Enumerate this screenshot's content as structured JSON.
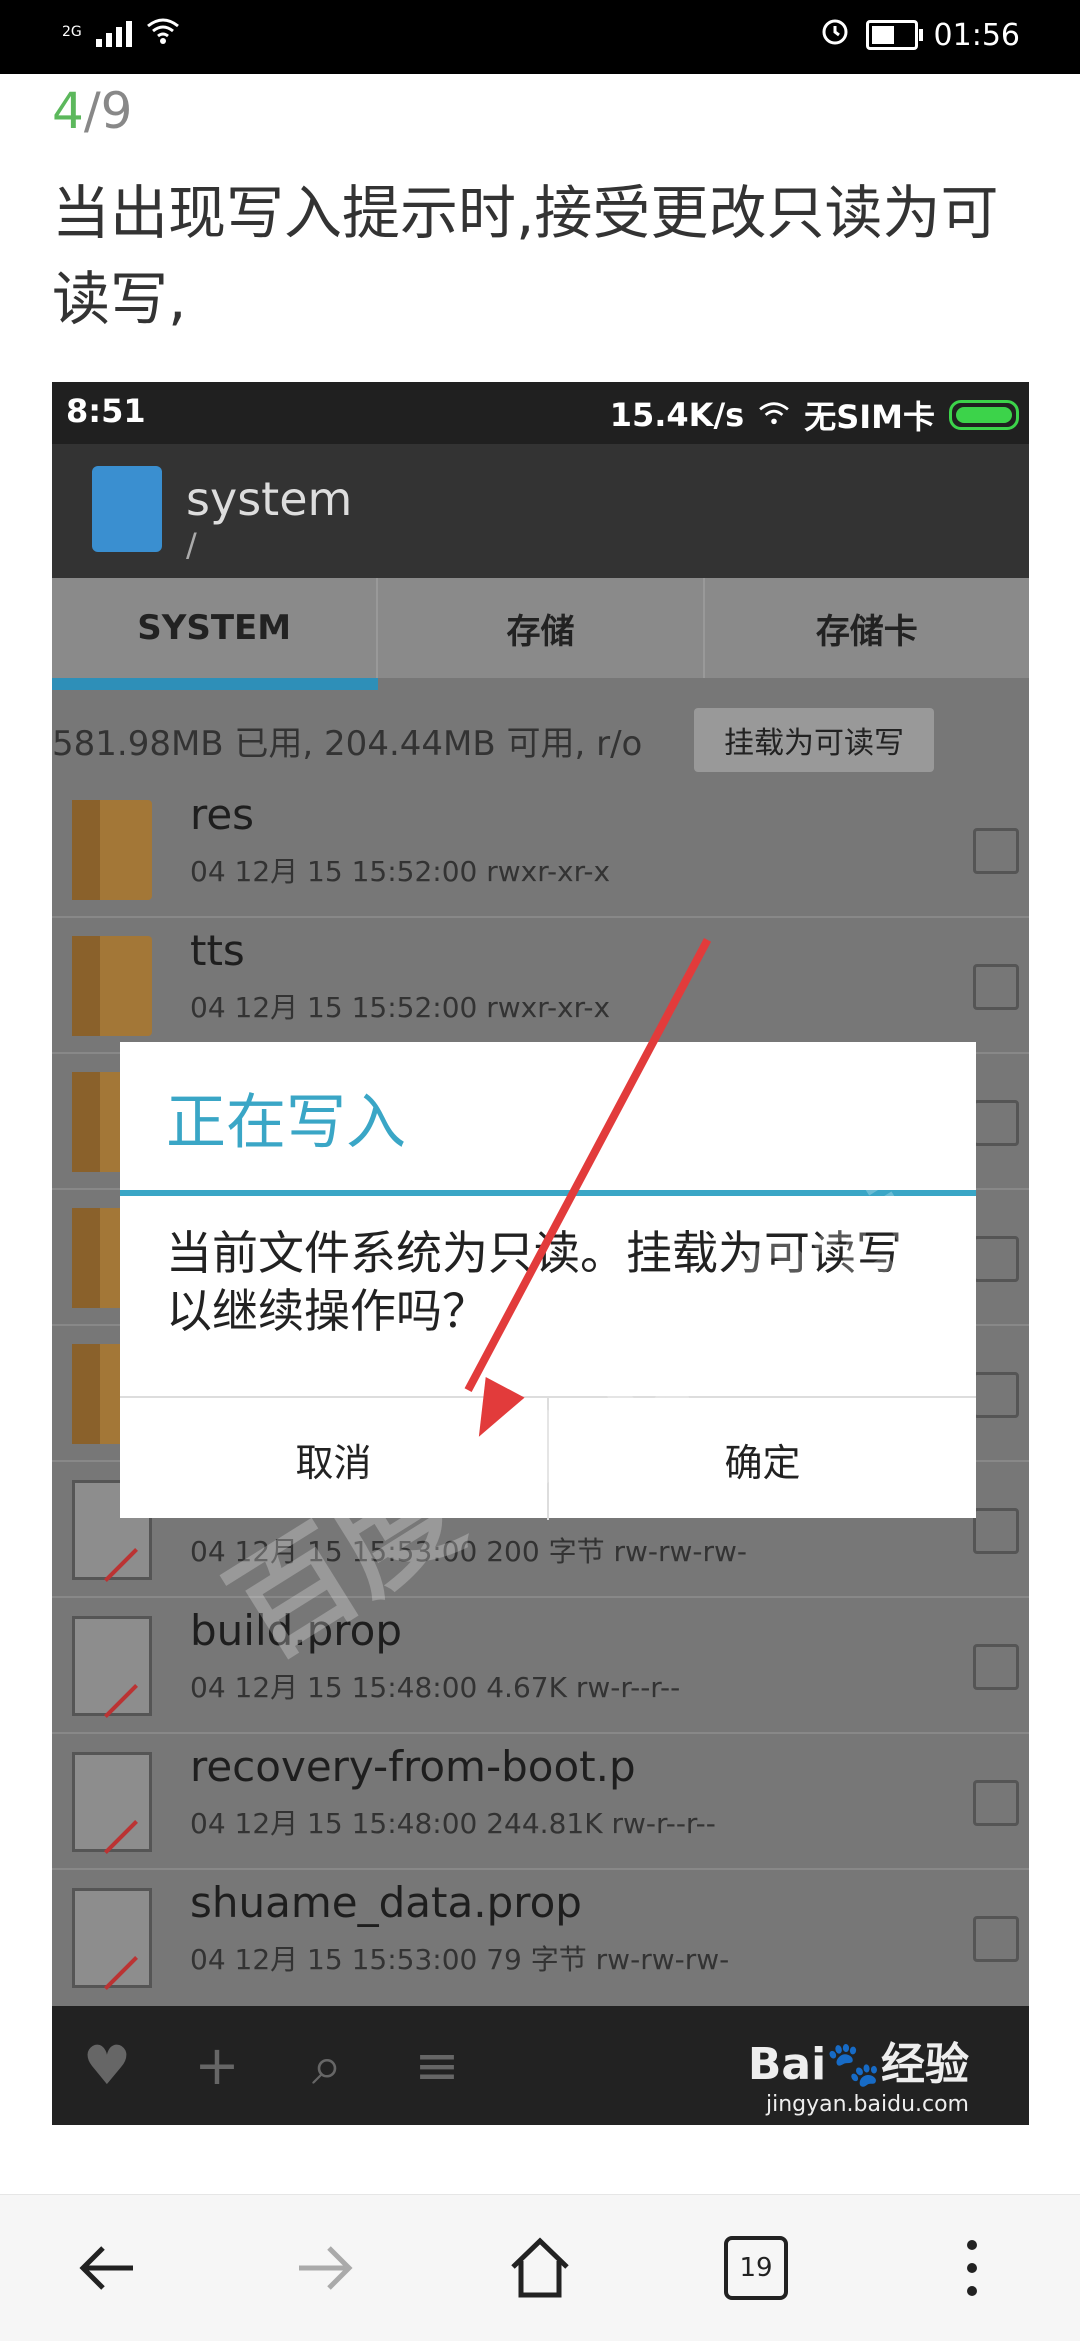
{
  "status_bar": {
    "network": "2G",
    "time": "01:56"
  },
  "article": {
    "step_current": "4",
    "step_total": "/9",
    "instruction": "当出现写入提示时,接受更改只读为可读写,"
  },
  "screenshot": {
    "status": {
      "time": "8:51",
      "speed": "15.4K/s",
      "sim": "无SIM卡"
    },
    "app": {
      "title": "system",
      "path": "/"
    },
    "tabs": [
      "SYSTEM",
      "存储",
      "存储卡"
    ],
    "storage_info": "581.98MB 已用, 204.44MB 可用, r/o",
    "mount_button": "挂载为可读写",
    "files": [
      {
        "name": "res",
        "meta": "04 12月 15 15:52:00   rwxr-xr-x",
        "type": "folder"
      },
      {
        "name": "tts",
        "meta": "04 12月 15 15:52:00   rwxr-xr-x",
        "type": "folder"
      },
      {
        "name": "",
        "meta": "",
        "type": "folder"
      },
      {
        "name": "",
        "meta": "",
        "type": "folder"
      },
      {
        "name": "",
        "meta": "",
        "type": "folder"
      },
      {
        "name": "",
        "meta": "04 12月 15 15:53:00  200 字节  rw-rw-rw-",
        "type": "file"
      },
      {
        "name": "build.prop",
        "meta": "04 12月 15 15:48:00  4.67K  rw-r--r--",
        "type": "file"
      },
      {
        "name": "recovery-from-boot.p",
        "meta": "04 12月 15 15:48:00  244.81K  rw-r--r--",
        "type": "file"
      },
      {
        "name": "shuame_data.prop",
        "meta": "04 12月 15 15:53:00  79 字节  rw-rw-rw-",
        "type": "file"
      }
    ],
    "dialog": {
      "title": "正在写入",
      "message": "当前文件系统为只读。挂载为可读写以继续操作吗？",
      "cancel": "取消",
      "confirm": "确定"
    },
    "watermark": "百度 D gu0zi",
    "baidu_logo": "Bai🐾经验",
    "baidu_url": "jingyan.baidu.com"
  },
  "browser_nav": {
    "tab_count": "19"
  }
}
